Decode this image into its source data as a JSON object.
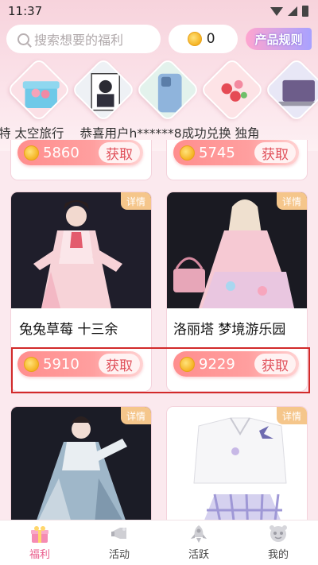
{
  "status_bar": {
    "time": "11:37"
  },
  "header": {
    "search_placeholder": "搜索想要的福利",
    "coin_balance": "0",
    "rules_button": "产品规则"
  },
  "carousel": {
    "items": [
      {
        "icon": "gift-box-icon"
      },
      {
        "icon": "comic-book-icon"
      },
      {
        "icon": "phone-icon"
      },
      {
        "icon": "hair-accessory-icon"
      },
      {
        "icon": "laptop-icon"
      }
    ]
  },
  "marquee": {
    "items": [
      "特 太空旅行",
      "恭喜用户h******8成功兑换 独角"
    ]
  },
  "products": [
    {
      "title": "",
      "price": "5860",
      "get_label": "获取"
    },
    {
      "title": "",
      "price": "5745",
      "get_label": "获取"
    },
    {
      "title": "兔兔草莓 十三余",
      "price": "5910",
      "get_label": "获取",
      "tag": "详情"
    },
    {
      "title": "洛丽塔 梦境游乐园",
      "price": "9229",
      "get_label": "获取",
      "tag": "详情"
    },
    {
      "title": "",
      "tag": "详情"
    },
    {
      "title": "",
      "tag": "详情"
    }
  ],
  "tabbar": {
    "items": [
      {
        "label": "福利",
        "icon": "gift-icon",
        "active": true
      },
      {
        "label": "活动",
        "icon": "megaphone-icon",
        "active": false
      },
      {
        "label": "活跃",
        "icon": "rocket-icon",
        "active": false
      },
      {
        "label": "我的",
        "icon": "profile-icon",
        "active": false
      }
    ]
  },
  "colors": {
    "accent": "#e95a8a",
    "price_pill": "#ff8e8e",
    "detail_tag": "#f5c68b",
    "highlight_box": "#d22a2a"
  }
}
